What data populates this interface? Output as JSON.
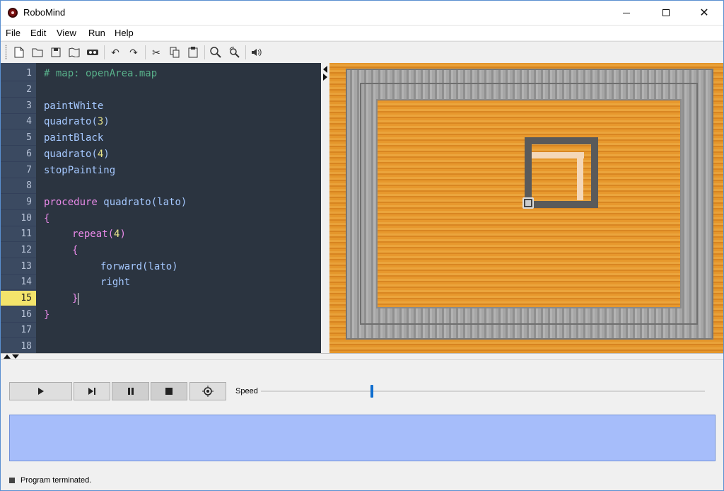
{
  "window": {
    "title": "RoboMind"
  },
  "menu": {
    "items": [
      "File",
      "Edit",
      "View",
      "Run",
      "Help"
    ]
  },
  "toolbar": {
    "icons": [
      "new-file-icon",
      "open-folder-icon",
      "save-icon",
      "map-icon",
      "robot-icon",
      "undo-icon",
      "redo-icon",
      "cut-icon",
      "copy-icon",
      "paste-icon",
      "find-icon",
      "find-replace-icon",
      "sound-icon"
    ]
  },
  "editor": {
    "line_numbers": [
      "1",
      "2",
      "3",
      "4",
      "5",
      "6",
      "7",
      "8",
      "9",
      "10",
      "11",
      "12",
      "13",
      "14",
      "15",
      "16",
      "17",
      "18"
    ],
    "active_line": "15",
    "lines": [
      {
        "type": "comment",
        "text": "# map: openArea.map"
      },
      {
        "type": "blank",
        "text": ""
      },
      {
        "type": "cmd",
        "text": "paintWhite"
      },
      {
        "type": "call",
        "name": "quadrato",
        "arg": "3"
      },
      {
        "type": "cmd",
        "text": "paintBlack"
      },
      {
        "type": "call",
        "name": "quadrato",
        "arg": "4"
      },
      {
        "type": "cmd",
        "text": "stopPainting"
      },
      {
        "type": "blank",
        "text": ""
      },
      {
        "type": "procedure",
        "keyword": "procedure",
        "name": "quadrato(lato)"
      },
      {
        "type": "brace",
        "text": "{"
      },
      {
        "type": "repeat",
        "keyword": "repeat(",
        "arg": "4",
        "close": ")"
      },
      {
        "type": "brace",
        "text": "{"
      },
      {
        "type": "cmd",
        "text": "forward(lato)"
      },
      {
        "type": "cmd",
        "text": "right"
      },
      {
        "type": "brace",
        "text": "}"
      },
      {
        "type": "brace",
        "text": "}"
      }
    ]
  },
  "controls": {
    "play": "play-icon",
    "step": "step-icon",
    "pause": "pause-icon",
    "stop": "stop-icon",
    "locate": "locate-robot-icon",
    "speed_label": "Speed",
    "speed_level": 0.25
  },
  "status": {
    "text": "Program terminated."
  },
  "colors": {
    "editor_bg": "#2b3440",
    "gutter": "#3b4a61",
    "active_line": "#f3e46b",
    "output_bg": "#a6bdfa",
    "slider_thumb": "#0f6ecf"
  }
}
